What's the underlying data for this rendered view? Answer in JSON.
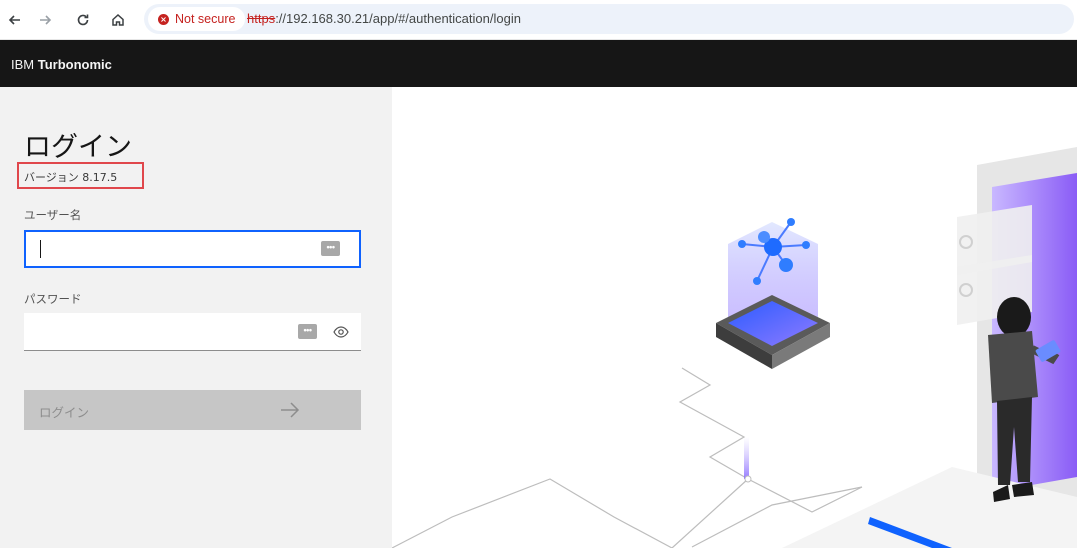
{
  "browser": {
    "security_label": "Not secure",
    "url_scheme": "https",
    "url_rest": "://192.168.30.21/app/#/authentication/login"
  },
  "app": {
    "title_prefix": "IBM ",
    "title_brand": "Turbonomic"
  },
  "login": {
    "title": "ログイン",
    "version": "バージョン 8.17.5",
    "username_label": "ユーザー名",
    "username_value": "",
    "password_label": "パスワード",
    "password_value": "",
    "submit_label": "ログイン",
    "key_icon_text": "•••"
  },
  "icons": {
    "back": "arrow-left-icon",
    "forward": "arrow-right-icon",
    "reload": "reload-icon",
    "home": "home-icon",
    "warning": "warning-circle-icon",
    "password_manager": "password-key-icon",
    "show_password": "eye-icon",
    "submit_arrow": "arrow-right-icon"
  },
  "colors": {
    "header_bg": "#161616",
    "focus_border": "#0f62fe",
    "highlight_box": "#e0474c",
    "panel_bg": "#f2f2f2",
    "disabled_button": "#c6c6c6",
    "warning_red": "#c5221f"
  }
}
